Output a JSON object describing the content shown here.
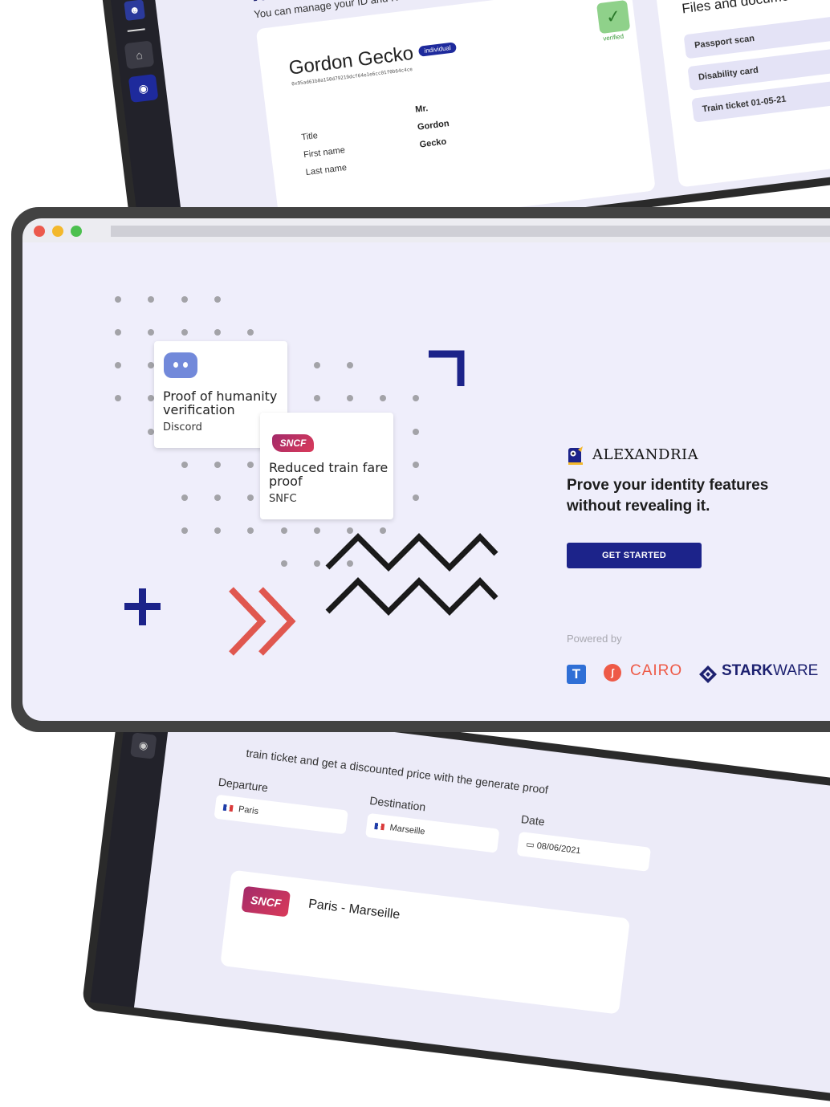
{
  "identity_board": {
    "title": "Identity Board",
    "subtitle": "You can manage your ID and KYC data through this board",
    "name": "Gordon Gecko",
    "badge": "individual",
    "address": "0x95ad61b0a150d79219dcf64e1e6cc01f0b64c4ce",
    "verified_label": "verified",
    "fields": [
      {
        "label": "Title",
        "value": "Mr."
      },
      {
        "label": "First name",
        "value": "Gordon"
      },
      {
        "label": "Last name",
        "value": "Gecko"
      }
    ],
    "files_title": "Files and documents",
    "files": [
      "Passport scan",
      "Disability card",
      "Train ticket 01-05-21"
    ]
  },
  "train_form": {
    "subtitle": "train ticket and get a discounted price with the generate proof",
    "departure_label": "Departure",
    "departure_value": "Paris",
    "destination_label": "Destination",
    "destination_value": "Marseille",
    "date_label": "Date",
    "date_value": "08/06/2021",
    "ticket_route": "Paris - Marseille",
    "sncf_logo": "SNCF"
  },
  "hero": {
    "card1": {
      "title_line1": "Proof of humanity",
      "title_line2": "verification",
      "source": "Discord",
      "icon": "discord-icon"
    },
    "card2": {
      "title_line1": "Reduced train fare",
      "title_line2": "proof",
      "source": "SNFC",
      "logo_text": "SNCF"
    },
    "brand": "ALEXANDRIA",
    "headline_line1": "Prove your identity features",
    "headline_line2": "without revealing it.",
    "cta": "GET STARTED",
    "powered_by": "Powered by",
    "partners": {
      "cairo": "CAIRO",
      "stark_bold": "STARK",
      "stark_light": "WARE"
    }
  },
  "colors": {
    "navy": "#1c238a",
    "coral": "#e0574f",
    "background": "#efeefb",
    "cairo": "#ee5a47",
    "discord": "#7289da"
  }
}
